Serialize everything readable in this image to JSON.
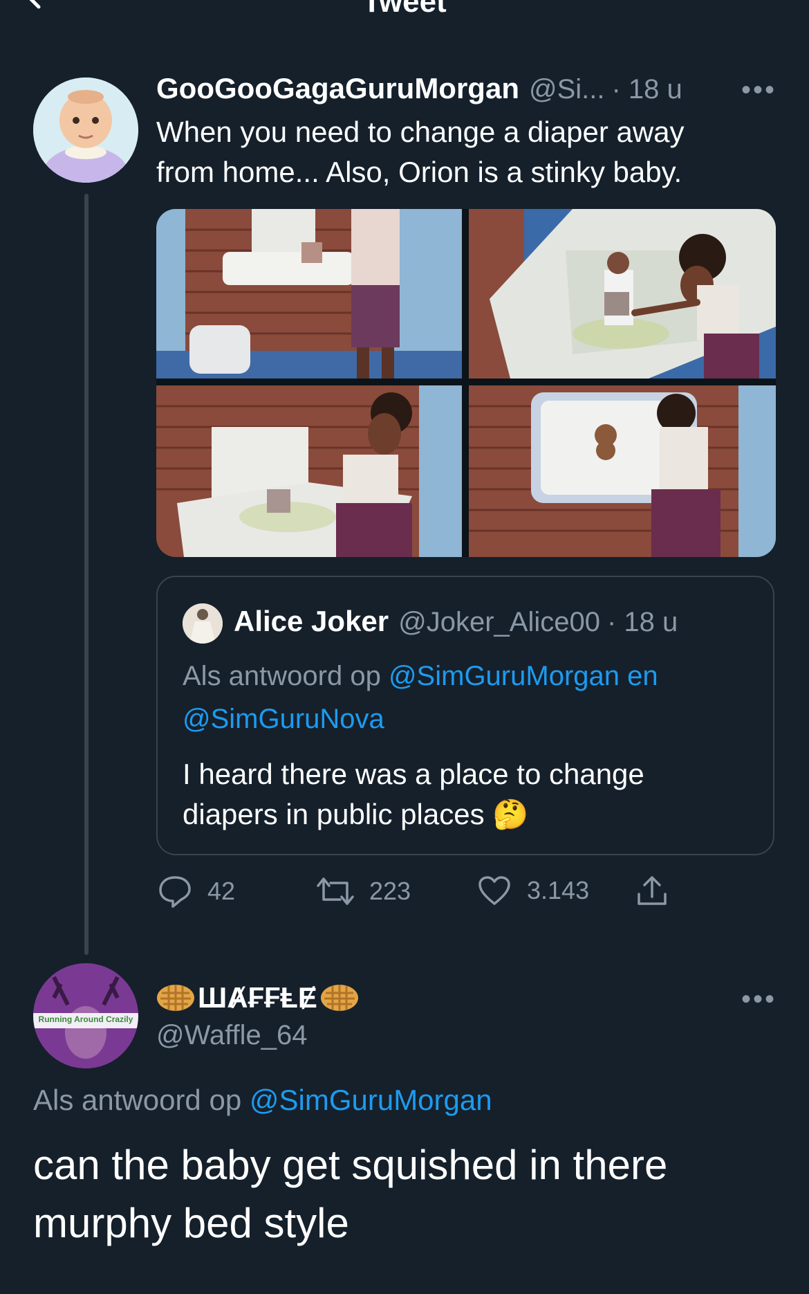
{
  "header": {
    "title": "Tweet"
  },
  "tweet": {
    "name": "GooGooGagaGuruMorgan",
    "handle": "@Si...",
    "time": "· 18 u",
    "text_line1": "When you need to change a diaper away",
    "text_line2": "from home... Also, Orion is a stinky baby.",
    "quote": {
      "name": "Alice Joker",
      "handle": "@Joker_Alice00",
      "time": "· 18 u",
      "reply_prefix": "Als antwoord op ",
      "reply_to_1": "@SimGuruMorgan en",
      "reply_to_2": "@SimGuruNova",
      "text_line1": "I heard there was a place to change",
      "text_line2": "diapers in public places",
      "emoji": "🤔"
    },
    "stats": {
      "replies": "42",
      "retweets": "223",
      "likes": "3.143"
    }
  },
  "reply": {
    "name": "🧇Ш₳₣₣ⱠɆ🧇",
    "name_display": "ШȺ₣₣ⱠɆ",
    "handle": "@Waffle_64",
    "avatar_banner": "Running Around Crazily",
    "reply_prefix": "Als antwoord op ",
    "reply_to": "@SimGuruMorgan",
    "text_line1": "can the baby get squished in there",
    "text_line2": "murphy bed style"
  },
  "colors": {
    "background": "#15202b",
    "link": "#1d9bf0",
    "muted": "#8b98a5",
    "border": "#38444d"
  }
}
